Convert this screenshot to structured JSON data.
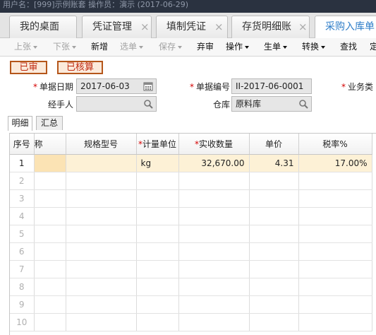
{
  "window": {
    "title": "用户名：[999]示例账套 操作员：演示  (2017-06-29)"
  },
  "tabs": [
    {
      "label": "我的桌面",
      "closable": false
    },
    {
      "label": "凭证管理",
      "closable": true
    },
    {
      "label": "填制凭证",
      "closable": true
    },
    {
      "label": "存货明细账",
      "closable": true
    },
    {
      "label": "采购入库单",
      "closable": false,
      "active": true
    }
  ],
  "close_glyph": "×",
  "toolbar": {
    "items": [
      {
        "label": "上张",
        "dropdown": true,
        "disabled": true
      },
      {
        "label": "下张",
        "dropdown": true,
        "disabled": true
      },
      {
        "label": "新增",
        "dropdown": false,
        "disabled": false
      },
      {
        "label": "选单",
        "dropdown": true,
        "disabled": true
      },
      {
        "label": "保存",
        "dropdown": true,
        "disabled": true
      },
      {
        "label": "弃审",
        "dropdown": false,
        "disabled": false
      },
      {
        "label": "操作",
        "dropdown": true,
        "disabled": false
      },
      {
        "label": "生单",
        "dropdown": true,
        "disabled": false
      },
      {
        "label": "转换",
        "dropdown": true,
        "disabled": false
      },
      {
        "label": "查找",
        "dropdown": false,
        "disabled": false
      },
      {
        "label": "定",
        "dropdown": false,
        "disabled": false
      }
    ]
  },
  "status_badges": {
    "audited": "已审",
    "checked": "已核算"
  },
  "form": {
    "doc_date": {
      "label": "单据日期",
      "value": "2017-06-03",
      "required": true,
      "icon": "calendar-icon"
    },
    "doc_no": {
      "label": "单据编号",
      "value": "II-2017-06-0001",
      "required": true
    },
    "biz_type": {
      "label": "业务类",
      "required": true
    },
    "handler": {
      "label": "经手人",
      "value": "",
      "icon": "search-icon"
    },
    "warehouse": {
      "label": "仓库",
      "value": "原料库",
      "icon": "search-icon"
    }
  },
  "subtabs": [
    {
      "label": "明细",
      "active": true
    },
    {
      "label": "汇总",
      "active": false
    }
  ],
  "grid": {
    "columns": [
      {
        "label": "序号",
        "required": false
      },
      {
        "label": "称",
        "required": false
      },
      {
        "label": "规格型号",
        "required": false
      },
      {
        "label": "计量单位",
        "required": true
      },
      {
        "label": "实收数量",
        "required": true
      },
      {
        "label": "单价",
        "required": false
      },
      {
        "label": "税率%",
        "required": false
      }
    ],
    "rows": [
      {
        "seq": "1",
        "name": "",
        "spec": "",
        "unit": "kg",
        "qty": "32,670.00",
        "price": "4.31",
        "tax": "17.00%"
      }
    ],
    "empty_rows": [
      "2",
      "3",
      "4",
      "5",
      "6",
      "7",
      "8",
      "9",
      "10"
    ]
  }
}
